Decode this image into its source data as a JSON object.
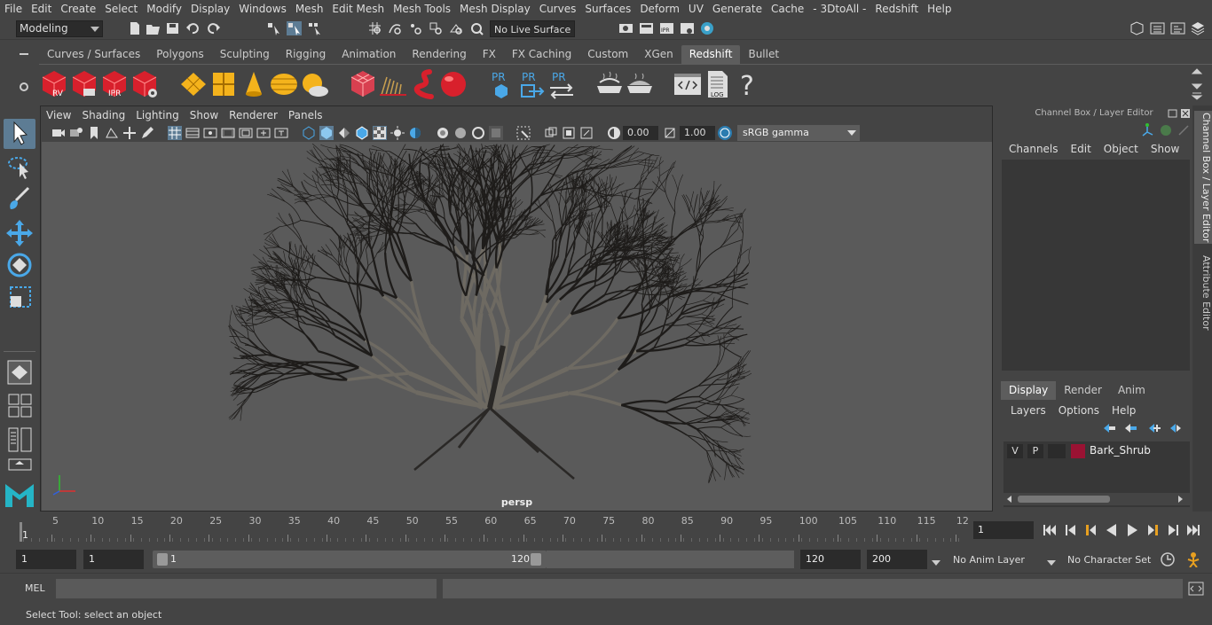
{
  "menubar": [
    "File",
    "Edit",
    "Create",
    "Select",
    "Modify",
    "Display",
    "Windows",
    "Mesh",
    "Edit Mesh",
    "Mesh Tools",
    "Mesh Display",
    "Curves",
    "Surfaces",
    "Deform",
    "UV",
    "Generate",
    "Cache",
    "- 3DtoAll -",
    "Redshift",
    "Help"
  ],
  "statusline": {
    "mode": "Modeling",
    "live_surface": "No Live Surface"
  },
  "shelf_tabs": [
    "Curves / Surfaces",
    "Polygons",
    "Sculpting",
    "Rigging",
    "Animation",
    "Rendering",
    "FX",
    "FX Caching",
    "Custom",
    "XGen",
    "Redshift",
    "Bullet"
  ],
  "shelf_active_tab": "Redshift",
  "shelf_icons": {
    "rv_label": "RV",
    "ipr_label": "IPR",
    "pr1_label": "PR",
    "pr2_label": "PR",
    "pr3_label": "PR",
    "log_label": "LOG",
    "help_glyph": "?"
  },
  "viewport": {
    "menu": [
      "View",
      "Shading",
      "Lighting",
      "Show",
      "Renderer",
      "Panels"
    ],
    "exposure": "0.00",
    "gamma_value": "1.00",
    "color_space": "sRGB gamma",
    "camera_label": "persp"
  },
  "right_panel": {
    "title": "Channel Box / Layer Editor",
    "menu": [
      "Channels",
      "Edit",
      "Object",
      "Show"
    ],
    "tabs": [
      "Display",
      "Render",
      "Anim"
    ],
    "active_tab": "Display",
    "layer_menu": [
      "Layers",
      "Options",
      "Help"
    ],
    "layers": [
      {
        "visible": "V",
        "playback": "P",
        "name": "Bark_Shrub",
        "color": "#9a1233"
      }
    ]
  },
  "side_tabs": [
    "Channel Box / Layer Editor",
    "Attribute Editor"
  ],
  "timeslider": {
    "ticks": [
      "5",
      "10",
      "15",
      "20",
      "25",
      "30",
      "35",
      "40",
      "45",
      "50",
      "55",
      "60",
      "65",
      "70",
      "75",
      "80",
      "85",
      "90",
      "95",
      "100",
      "105",
      "110",
      "115",
      "12"
    ],
    "current_frame": "1",
    "current_frame_field": "1"
  },
  "range": {
    "start": "1",
    "playback_start": "1",
    "slider_start": "1",
    "slider_end": "120",
    "playback_end": "120",
    "end": "200",
    "anim_layer": "No Anim Layer",
    "character_set": "No Character Set"
  },
  "commandline": {
    "label": "MEL"
  },
  "helpline": {
    "text": "Select Tool: select an object"
  },
  "colors": {
    "panel": "#444444",
    "field": "#2b2b2b",
    "viewport": "#5a5a5a",
    "accent": "#5d7c94",
    "redshift_red": "#d8202c"
  }
}
